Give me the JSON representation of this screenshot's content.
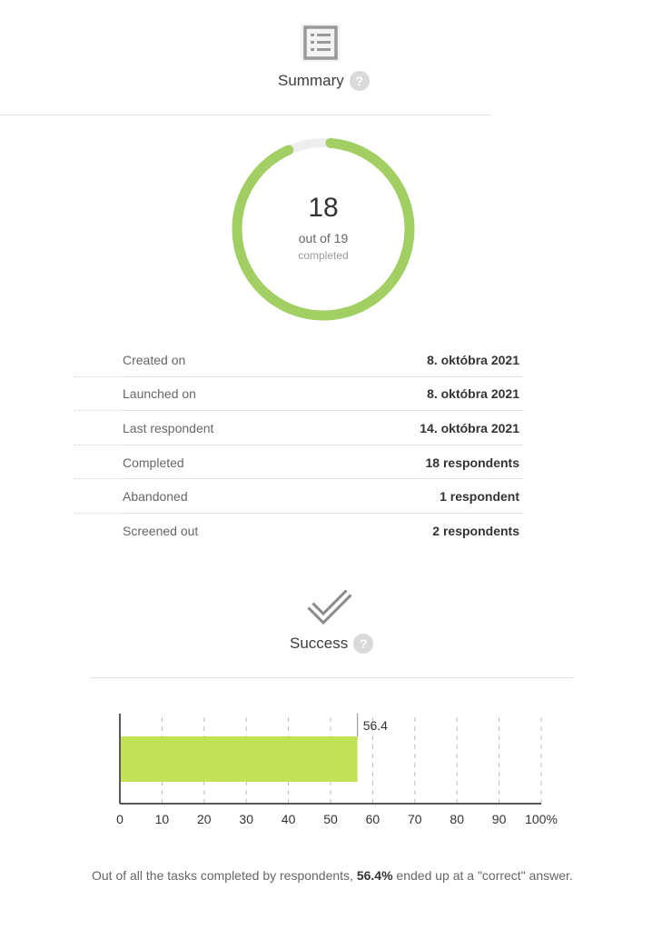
{
  "summary": {
    "title": "Summary",
    "help": "?",
    "icon": "list-icon"
  },
  "progress": {
    "completed": "18",
    "out_of": "out of 19",
    "sub": "completed",
    "fraction": 0.947,
    "color": "#a1cf64",
    "track_color": "#eeeeee"
  },
  "stats": [
    {
      "label": "Created on",
      "value": "8. októbra 2021"
    },
    {
      "label": "Launched on",
      "value": "8. októbra 2021"
    },
    {
      "label": "Last respondent",
      "value": "14. októbra 2021"
    },
    {
      "label": "Completed",
      "value": "18 respondents"
    },
    {
      "label": "Abandoned",
      "value": "1 respondent"
    },
    {
      "label": "Screened out",
      "value": "2 respondents"
    }
  ],
  "success": {
    "title": "Success",
    "help": "?",
    "icon": "checkmark-icon",
    "note_prefix": "Out of all the tasks completed by respondents, ",
    "note_value": "56.4%",
    "note_suffix": " ended up at a \"correct\" answer."
  },
  "chart_data": {
    "type": "bar",
    "orientation": "horizontal",
    "values": [
      56.4
    ],
    "data_labels": [
      "56.4"
    ],
    "xlim": [
      0,
      100
    ],
    "x_ticks": [
      "0",
      "10",
      "20",
      "30",
      "40",
      "50",
      "60",
      "70",
      "80",
      "90",
      "100%"
    ],
    "grid": "vertical dashed",
    "bar_color": "#c1e256"
  }
}
